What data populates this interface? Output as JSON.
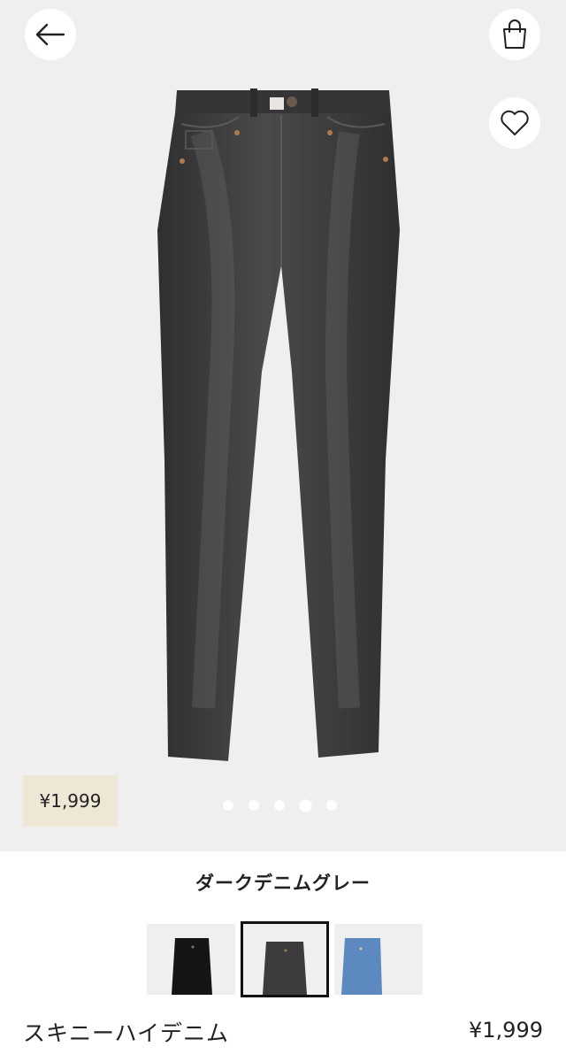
{
  "hero": {
    "price": "¥1,999",
    "carousel": {
      "count": 5,
      "active_index": 3
    }
  },
  "icons": {
    "back": "arrow-left-icon",
    "bag": "shopping-bag-icon",
    "favorite": "heart-icon"
  },
  "color": {
    "name": "ダークデニムグレー",
    "swatches": [
      {
        "name": "black",
        "color": "#1a1a1a"
      },
      {
        "name": "dark-denim-grey",
        "color": "#3e3e40",
        "selected": true
      },
      {
        "name": "light-blue-denim",
        "color": "#5d8cc4"
      }
    ]
  },
  "product": {
    "name": "スキニーハイデニム",
    "price": "¥1,999"
  }
}
